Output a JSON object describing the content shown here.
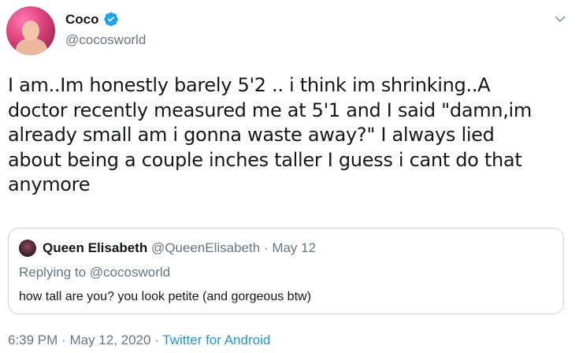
{
  "author": {
    "display_name": "Coco",
    "handle": "@cocosworld",
    "verified": true
  },
  "tweet": {
    "lines": [
      "I am..Im honestly barely 5'2 .. i think im shrinking..A",
      "doctor recently measured me at 5'1 and I said \"damn,im",
      "already small am i gonna waste away?\" I always lied",
      "about being a couple inches taller I guess i cant do that",
      "anymore"
    ]
  },
  "quoted": {
    "name": "Queen Elisabeth",
    "handle": "@QueenElisabeth",
    "separator": "·",
    "date": "May 12",
    "replying_prefix": "Replying to",
    "replying_to": "@cocosworld",
    "text": "how tall are you? you look petite (and gorgeous btw)"
  },
  "footer": {
    "time": "6:39 PM",
    "sep1": "·",
    "date": "May 12, 2020",
    "sep2": "·",
    "source": "Twitter for Android"
  },
  "icons": {
    "verified": "verified-badge-icon",
    "caret": "chevron-down-icon"
  },
  "colors": {
    "link": "#1b95e0",
    "secondary": "#657786",
    "border": "#ccd6dd",
    "verified": "#1da1f2"
  }
}
